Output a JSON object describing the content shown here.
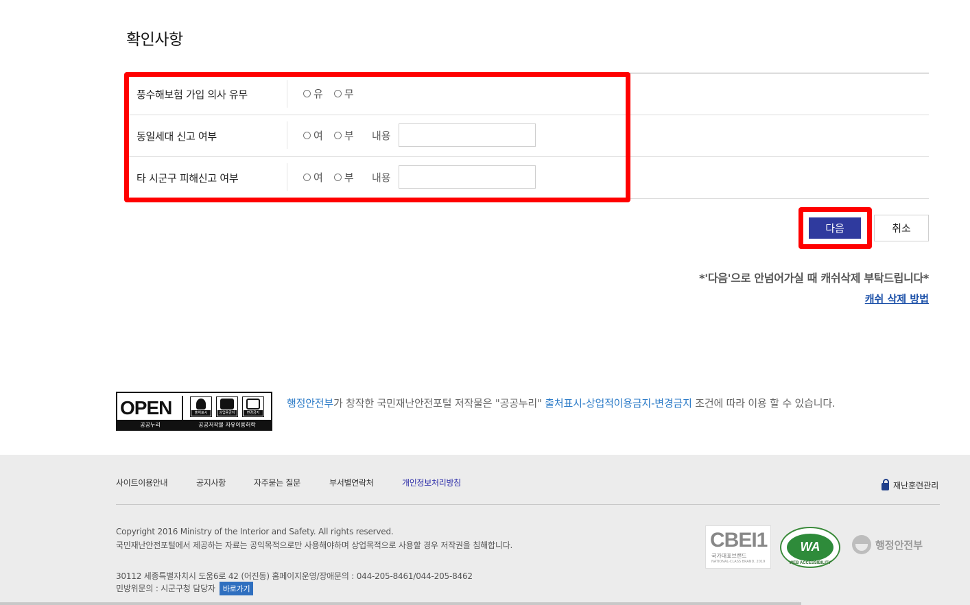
{
  "page_title": "확인사항",
  "form": {
    "rows": [
      {
        "label": "풍수해보험 가입 의사 유무",
        "options": [
          "유",
          "무"
        ],
        "has_content": false
      },
      {
        "label": "동일세대 신고 여부",
        "options": [
          "여",
          "부"
        ],
        "has_content": true,
        "content_label": "내용",
        "content_value": ""
      },
      {
        "label": "타 시군구 피해신고 여부",
        "options": [
          "여",
          "부"
        ],
        "has_content": true,
        "content_label": "내용",
        "content_value": ""
      }
    ]
  },
  "actions": {
    "next_label": "다음",
    "cancel_label": "취소"
  },
  "notice": "*'다음'으로 안넘어가실 때 캐쉬삭제 부탁드립니다*",
  "cache_link": "캐쉬 삭제 방법",
  "license": {
    "badge_open": "OPEN",
    "badge_left": "공공누리",
    "badge_right": "공공저작물 자유이용허락",
    "icon_labels": [
      "출처표시",
      "상업용금지",
      "변경금지"
    ],
    "text_org": "행정안전부",
    "text_mid": "가 창작한 국민재난안전포털 저작물은 \"공공누리\" ",
    "text_type": "출처표시-상업적이용금지-변경금지",
    "text_end": " 조건에 따라 이용 할 수 있습니다."
  },
  "footer": {
    "nav": [
      "사이트이용안내",
      "공지사항",
      "자주묻는 질문",
      "부서별연락처",
      "개인정보처리방침"
    ],
    "admin_link": "재난훈련관리",
    "copyright": "Copyright 2016 Ministry of the Interior and Safety. All rights reserved.",
    "disclaimer": "국민재난안전포털에서 제공하는 자료는 공익목적으로만 사용해야하며 상업목적으로 사용할 경우 저작권을 침해합니다.",
    "address": "30112 세종특별자치시 도움6로 42 (어진동)  홈페이지운영/장애문의 : 044-205-8461/044-205-8462",
    "complaint": "민방위문의 : 시군구청 담당자",
    "shortcut": "바로가기",
    "cbei_big": "CBEI1",
    "cbei_sub": "국가대표브랜드",
    "cbei_tiny": "NATIONAL-CLASS BRAND, 2019",
    "wa_text": "WA",
    "wa_caption": "WEB ACCESSIBILITY",
    "ministry": "행정안전부"
  },
  "colors": {
    "highlight": "#ff0000",
    "next_button": "#2f3a9e",
    "link_blue": "#2a7ac7"
  }
}
